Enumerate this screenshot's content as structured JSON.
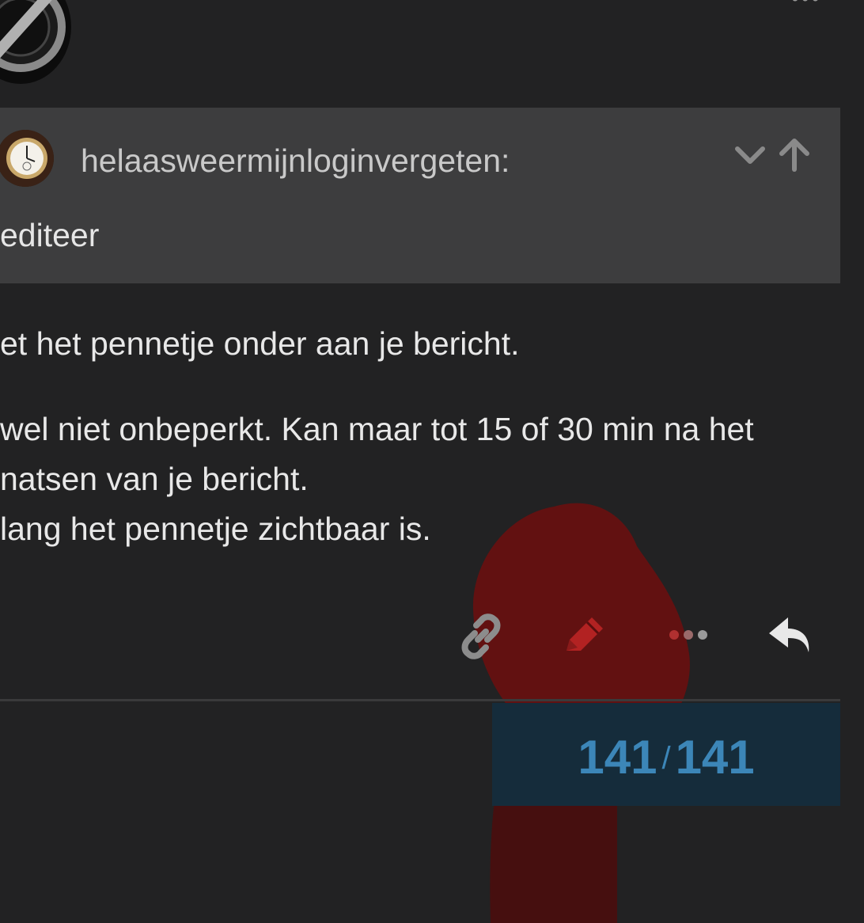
{
  "top_menu_dots": "•••",
  "quote": {
    "author": "helaasweermijnloginvergeten:",
    "text": "editeer",
    "expand_icon": "chevron-down-icon",
    "goto_icon": "arrow-up-icon"
  },
  "post": {
    "lines": [
      "et het pennetje onder aan je bericht.",
      "wel niet onbeperkt. Kan maar tot 15 of 30 min na het",
      "natsen van je bericht.",
      "lang het pennetje zichtbaar is."
    ]
  },
  "actions": [
    {
      "icon": "link-icon"
    },
    {
      "icon": "pencil-icon"
    },
    {
      "icon": "more-icon"
    },
    {
      "icon": "reply-icon"
    }
  ],
  "progress": {
    "current": "141",
    "separator": "/",
    "total": "141"
  },
  "colors": {
    "background": "#222223",
    "quote_background": "#3d3d3e",
    "progress_background": "#152c3b",
    "progress_text": "#3c86b8",
    "edit_icon": "#b22222"
  }
}
